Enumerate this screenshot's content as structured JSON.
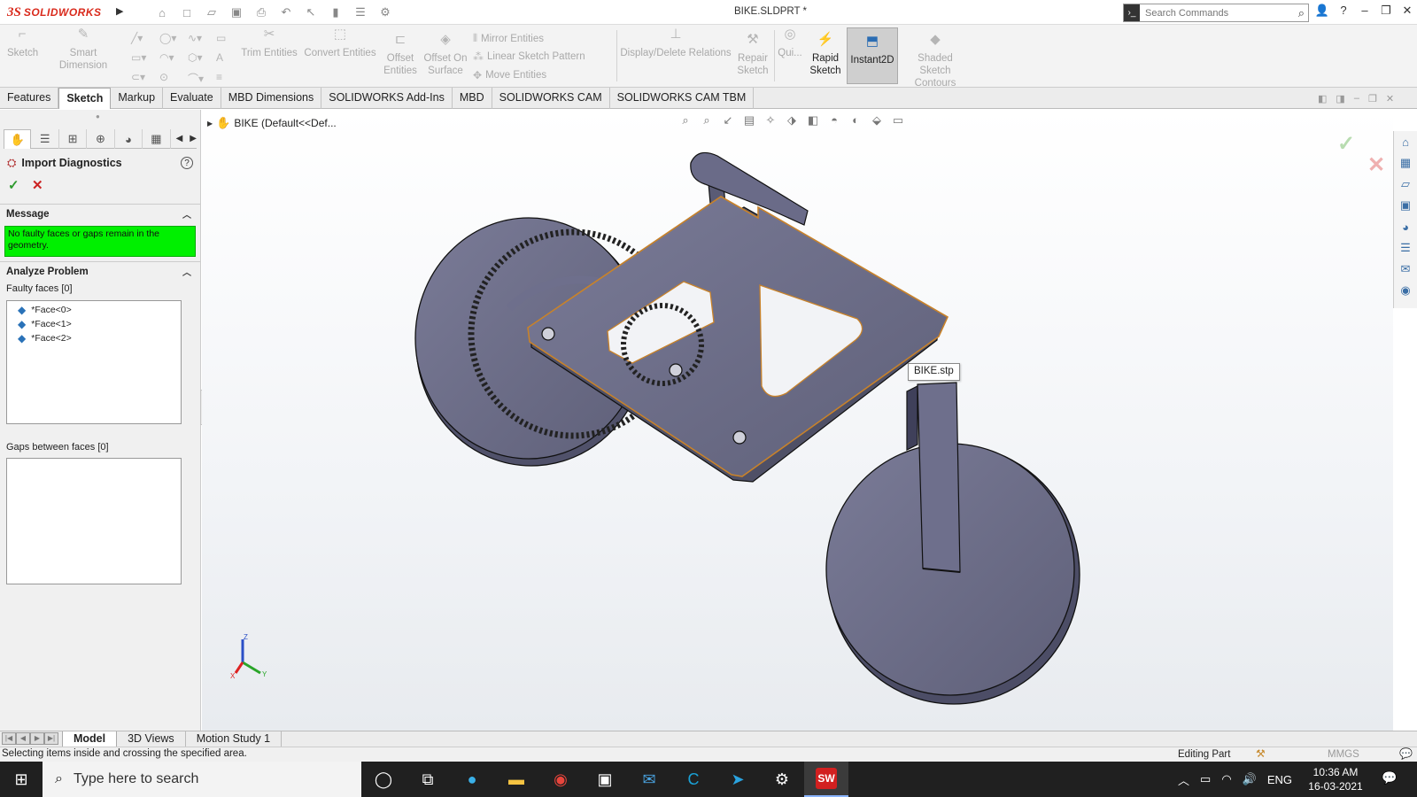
{
  "titlebar": {
    "logo_ds": "3S",
    "logo_sw": "SOLIDWORKS",
    "doc_title": "BIKE.SLDPRT *",
    "search_placeholder": "Search Commands"
  },
  "ribbon": {
    "sketch": "Sketch",
    "smart_dimension": "Smart Dimension",
    "trim_entities": "Trim Entities",
    "convert_entities": "Convert Entities",
    "offset_entities_1": "Offset",
    "offset_entities_2": "Entities",
    "offset_on_surface_1": "Offset On",
    "offset_on_surface_2": "Surface",
    "mirror_entities": "Mirror Entities",
    "linear_sketch_pattern": "Linear Sketch Pattern",
    "move_entities": "Move Entities",
    "display_delete_relations": "Display/Delete Relations",
    "repair_sketch_1": "Repair",
    "repair_sketch_2": "Sketch",
    "quick_snaps": "Qui...",
    "rapid_sketch_1": "Rapid",
    "rapid_sketch_2": "Sketch",
    "instant2d": "Instant2D",
    "shaded_contours_1": "Shaded Sketch",
    "shaded_contours_2": "Contours"
  },
  "tabs": [
    "Features",
    "Sketch",
    "Markup",
    "Evaluate",
    "MBD Dimensions",
    "SOLIDWORKS Add-Ins",
    "MBD",
    "SOLIDWORKS CAM",
    "SOLIDWORKS CAM TBM"
  ],
  "panel": {
    "title": "Import Diagnostics",
    "message_header": "Message",
    "message_text": "No faulty faces or gaps remain in the geometry.",
    "analyze_header": "Analyze Problem",
    "faulty_faces_label": "Faulty faces [0]",
    "faces": [
      "*Face<0>",
      "*Face<1>",
      "*Face<2>"
    ],
    "gaps_label": "Gaps between faces [0]"
  },
  "graphics": {
    "tree_label": "BIKE  (Default<<Def...",
    "tooltip": "BIKE.stp",
    "triad_x": "X",
    "triad_y": "Y",
    "triad_z": "Z"
  },
  "model_tabs": [
    "Model",
    "3D Views",
    "Motion Study 1"
  ],
  "status": {
    "message": "Selecting items inside and crossing the specified area.",
    "mode": "Editing Part",
    "units": "MMGS"
  },
  "taskbar": {
    "search_placeholder": "Type here to search",
    "language": "ENG",
    "time": "10:36 AM",
    "date": "16-03-2021",
    "sw_badge": "SW"
  },
  "colors": {
    "message_bg": "#00f000",
    "part_face": "#6e6f8c",
    "part_edge": "#202020",
    "selection_edge": "#c8822a",
    "accent": "#d92a1c"
  }
}
